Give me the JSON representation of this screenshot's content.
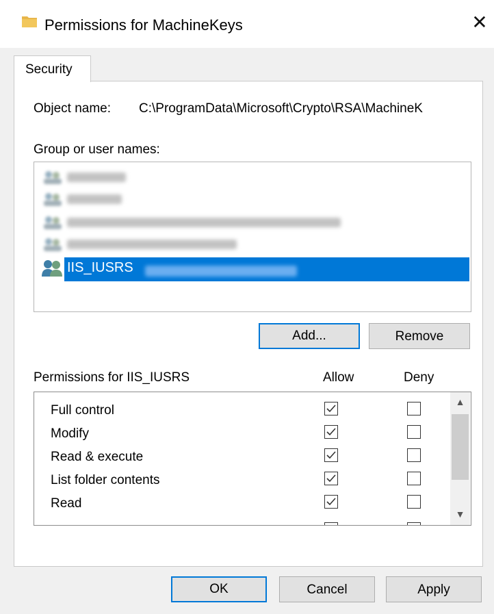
{
  "window": {
    "title": "Permissions for MachineKeys",
    "close_label": "✕"
  },
  "tabs": [
    {
      "label": "Security"
    }
  ],
  "object": {
    "label": "Object name:",
    "value": "C:\\ProgramData\\Microsoft\\Crypto\\RSA\\MachineK"
  },
  "group_list": {
    "label": "Group or user names:",
    "selected_name": "IIS_IUSRS"
  },
  "buttons": {
    "add": "Add...",
    "remove": "Remove",
    "ok": "OK",
    "cancel": "Cancel",
    "apply": "Apply"
  },
  "permissions": {
    "label": "Permissions for IIS_IUSRS",
    "allow_header": "Allow",
    "deny_header": "Deny",
    "rows": [
      {
        "name": "Full control",
        "allow": true,
        "deny": false
      },
      {
        "name": "Modify",
        "allow": true,
        "deny": false
      },
      {
        "name": "Read & execute",
        "allow": true,
        "deny": false
      },
      {
        "name": "List folder contents",
        "allow": true,
        "deny": false
      },
      {
        "name": "Read",
        "allow": true,
        "deny": false
      }
    ]
  },
  "icons": {
    "title": "folder-icon",
    "group": "user-group-icon"
  },
  "colors": {
    "selection": "#0078d7",
    "folder": "#e8b64a"
  }
}
